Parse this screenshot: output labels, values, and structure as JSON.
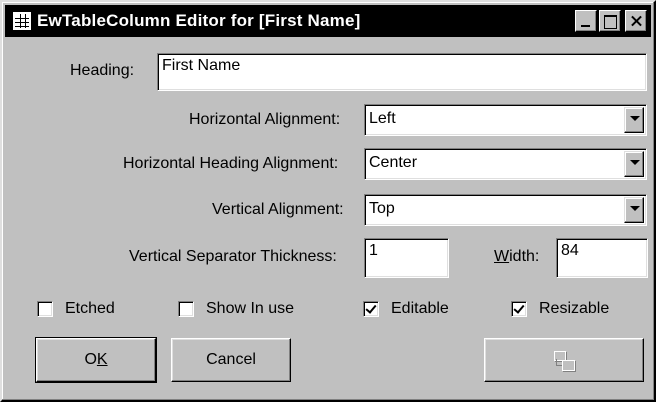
{
  "window": {
    "title": "EwTableColumn Editor for [First Name]"
  },
  "form": {
    "heading_label": "Heading:",
    "heading_value": "First Name",
    "h_align_label": "Horizontal Alignment:",
    "h_align_value": "Left",
    "h_heading_align_label": "Horizontal Heading Alignment:",
    "h_heading_align_value": "Center",
    "v_align_label": "Vertical Alignment:",
    "v_align_value": "Top",
    "v_sep_label": "Vertical Separator Thickness:",
    "v_sep_value": "1",
    "width_label_pre": "",
    "width_label_u": "W",
    "width_label_post": "idth:",
    "width_value": "84"
  },
  "checks": {
    "etched": {
      "label": "Etched",
      "checked": false
    },
    "show_in_use": {
      "label": "Show In use",
      "checked": false
    },
    "editable": {
      "label": "Editable",
      "checked": true
    },
    "resizable": {
      "label": "Resizable",
      "checked": true
    }
  },
  "buttons": {
    "ok_pre": "O",
    "ok_u": "K",
    "cancel": "Cancel"
  },
  "icons": {
    "title": "table-icon",
    "advanced_button": "swap-columns-icon"
  }
}
